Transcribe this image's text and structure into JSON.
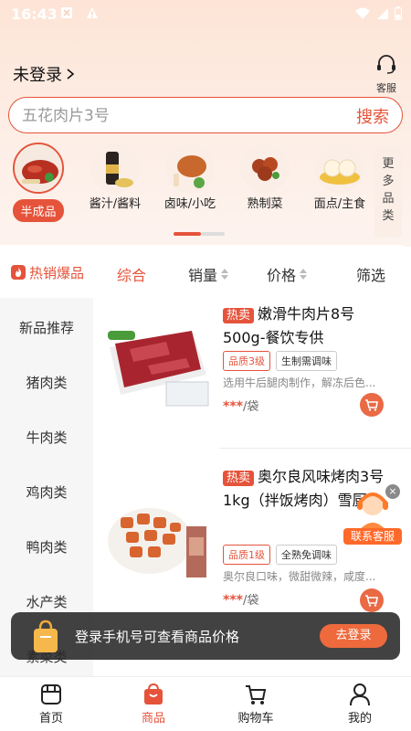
{
  "status": {
    "time": "16:43"
  },
  "header": {
    "login_label": "未登录",
    "service_label": "客服"
  },
  "search": {
    "placeholder": "五花肉片3号",
    "button": "搜索"
  },
  "categories": [
    {
      "label": "半成品",
      "active": true
    },
    {
      "label": "酱汁/酱料"
    },
    {
      "label": "卤味/小吃"
    },
    {
      "label": "熟制菜"
    },
    {
      "label": "面点/主食"
    }
  ],
  "more_categories": [
    "更",
    "多",
    "品",
    "类"
  ],
  "sort": {
    "hot_label": "热销爆品",
    "items": [
      "综合",
      "销量",
      "价格",
      "筛选"
    ]
  },
  "sidebar": [
    "新品推荐",
    "猪肉类",
    "牛肉类",
    "鸡肉类",
    "鸭肉类",
    "水产类",
    "素菜类"
  ],
  "products": [
    {
      "badge": "热卖",
      "title": "嫩滑牛肉片8号500g-餐饮专供",
      "tags": [
        "品质3级",
        "生制需调味"
      ],
      "desc": "选用牛后腿肉制作，解冻后色...",
      "price": "***",
      "unit": "/袋"
    },
    {
      "badge": "热卖",
      "title": "奥尔良风味烤肉3号1kg（拌饭烤肉）雪厨娘",
      "tags": [
        "品质1级",
        "全熟免调味"
      ],
      "desc": "奥尔良口味，微甜微辣，咸度...",
      "price": "***",
      "unit": "/袋"
    }
  ],
  "float_service": {
    "label": "联系客服",
    "close": "×"
  },
  "login_banner": {
    "text": "登录手机号可查看商品价格",
    "button": "去登录"
  },
  "tabbar": [
    {
      "label": "首页"
    },
    {
      "label": "商品",
      "active": true
    },
    {
      "label": "购物车"
    },
    {
      "label": "我的"
    }
  ],
  "colors": {
    "accent": "#e5533b",
    "header_bg": "#fde4d6"
  }
}
